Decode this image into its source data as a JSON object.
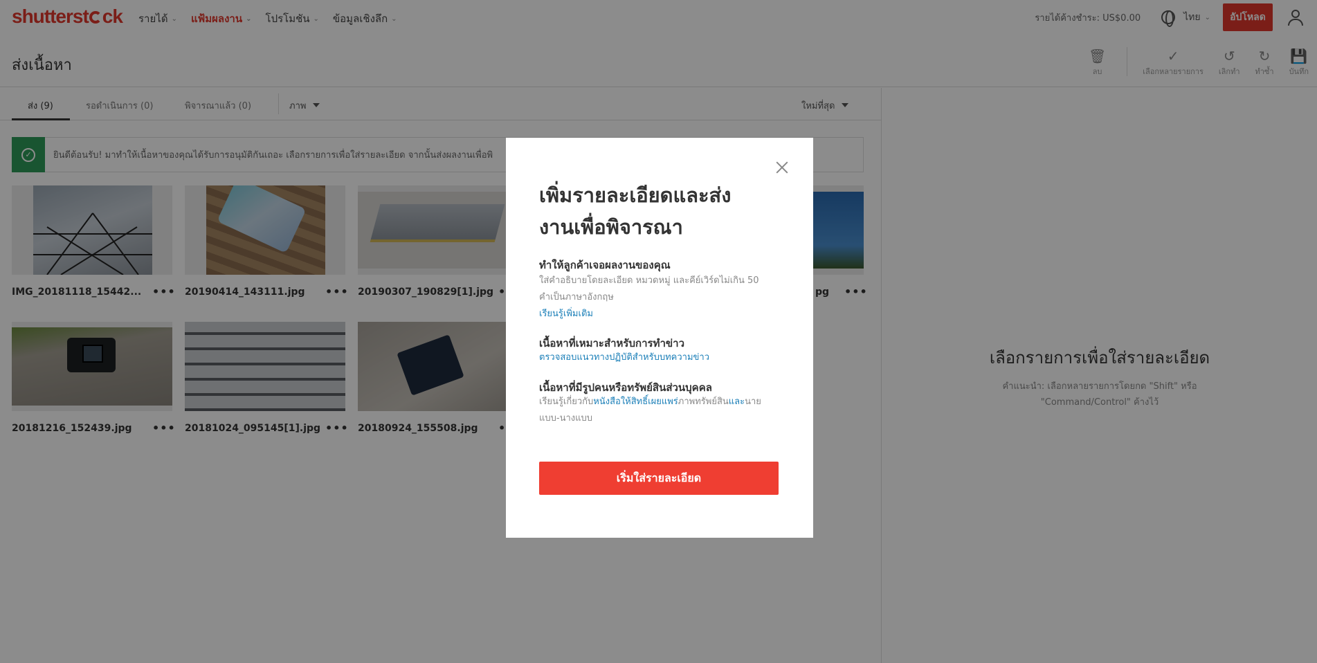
{
  "brand": {
    "logo": "shutterstock"
  },
  "nav": {
    "items": [
      {
        "label": "รายได้"
      },
      {
        "label": "แฟ้มผลงาน"
      },
      {
        "label": "โปรโมชัน"
      },
      {
        "label": "ข้อมูลเชิงลึก"
      }
    ],
    "earnings": "รายได้ค้างชำระ: US$0.00",
    "language": "ไทย",
    "upload_label": "อัปโหลด"
  },
  "page": {
    "title": "ส่งเนื้อหา"
  },
  "toolbar": {
    "delete": "ลบ",
    "select_multiple": "เลือกหลายรายการ",
    "undo": "เลิกทำ",
    "redo": "ทำซ้ำ",
    "save": "บันทึก"
  },
  "tabs": {
    "submit": "ส่ง (9)",
    "pending": "รอดำเนินการ (0)",
    "reviewed": "พิจารณาแล้ว (0)",
    "media_type": "ภาพ",
    "sort": "ใหม่ที่สุด"
  },
  "banner": {
    "text": "ยินดีต้อนรับ! มาทำให้เนื้อหาของคุณได้รับการอนุมัติกันเถอะ เลือกรายการเพื่อใส่รายละเอียด จากนั้นส่งผลงานเพื่อพิ"
  },
  "files": [
    {
      "name": "IMG_20181118_15442..."
    },
    {
      "name": "20190414_143111.jpg"
    },
    {
      "name": "20190307_190829[1].jpg"
    },
    {
      "name": "pg"
    },
    {
      "name": "20181216_152439.jpg"
    },
    {
      "name": "20181024_095145[1].jpg"
    },
    {
      "name": "20180924_155508.jpg"
    }
  ],
  "right_panel": {
    "title": "เลือกรายการเพื่อใส่รายละเอียด",
    "hint": "คำแนะนำ: เลือกหลายรายการโดยกด \"Shift\" หรือ \"Command/Control\" ค้างไว้"
  },
  "modal": {
    "title": "เพิ่มรายละเอียดและส่งงานเพื่อพิจารณา",
    "sec1_title": "ทำให้ลูกค้าเจอผลงานของคุณ",
    "sec1_text": "ใส่คำอธิบายโดยละเอียด หมวดหมู่ และคีย์เวิร์ดไม่เกิน 50 คำเป็นภาษาอังกฤษ",
    "sec1_link": "เรียนรู้เพิ่มเติม",
    "sec2_title": "เนื้อหาที่เหมาะสำหรับการทำข่าว",
    "sec2_link": "ตรวจสอบแนวทางปฏิบัติสำหรับบทความข่าว",
    "sec3_title": "เนื้อหาที่มีรูปคนหรือทรัพย์สินส่วนบุคคล",
    "sec3_text_a": "เรียนรู้เกี่ยวกับ",
    "sec3_link_a": "หนังสือให้สิทธิ์เผยแพร่",
    "sec3_text_b": "ภาพทรัพย์สิน",
    "sec3_link_b": "และ",
    "sec3_text_c": "นายแบบ-นางแบบ",
    "button": "เริ่มใส่รายละเอียด"
  }
}
